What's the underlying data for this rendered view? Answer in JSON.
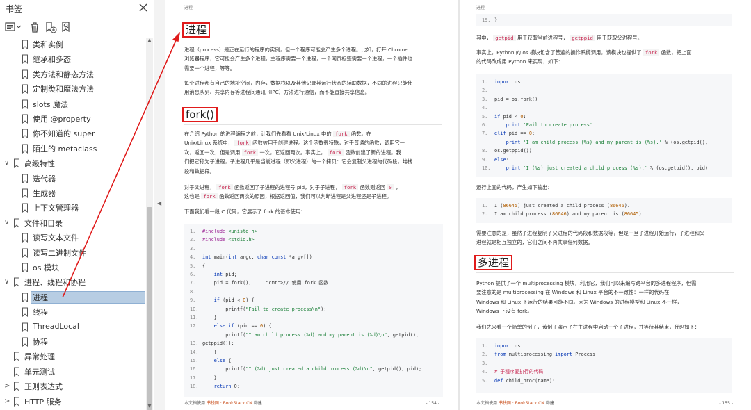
{
  "sidebar": {
    "title": "书签",
    "close_icon": "close-icon",
    "toolbar_icons": [
      "outline-menu-icon",
      "delete-bookmark-icon",
      "add-bookmark-icon",
      "find-bookmark-icon"
    ],
    "items": [
      {
        "label": "类和实例",
        "level": 2,
        "caret": ""
      },
      {
        "label": "继承和多态",
        "level": 2,
        "caret": ""
      },
      {
        "label": "类方法和静态方法",
        "level": 2,
        "caret": ""
      },
      {
        "label": "定制类和魔法方法",
        "level": 2,
        "caret": ""
      },
      {
        "label": "slots 魔法",
        "level": 2,
        "caret": ""
      },
      {
        "label": "使用 @property",
        "level": 2,
        "caret": ""
      },
      {
        "label": "你不知道的 super",
        "level": 2,
        "caret": ""
      },
      {
        "label": "陌生的 metaclass",
        "level": 2,
        "caret": ""
      },
      {
        "label": "高级特性",
        "level": 1,
        "caret": "∨"
      },
      {
        "label": "迭代器",
        "level": 2,
        "caret": ""
      },
      {
        "label": "生成器",
        "level": 2,
        "caret": ""
      },
      {
        "label": "上下文管理器",
        "level": 2,
        "caret": ""
      },
      {
        "label": "文件和目录",
        "level": 1,
        "caret": "∨"
      },
      {
        "label": "读写文本文件",
        "level": 2,
        "caret": ""
      },
      {
        "label": "读写二进制文件",
        "level": 2,
        "caret": ""
      },
      {
        "label": "os 模块",
        "level": 2,
        "caret": ""
      },
      {
        "label": "进程、线程和协程",
        "level": 1,
        "caret": "∨"
      },
      {
        "label": "进程",
        "level": 2,
        "caret": "",
        "active": true
      },
      {
        "label": "线程",
        "level": 2,
        "caret": ""
      },
      {
        "label": "ThreadLocal",
        "level": 2,
        "caret": ""
      },
      {
        "label": "协程",
        "level": 2,
        "caret": ""
      },
      {
        "label": "异常处理",
        "level": 1,
        "caret": ""
      },
      {
        "label": "单元测试",
        "level": 1,
        "caret": ""
      },
      {
        "label": "正则表达式",
        "level": 1,
        "caret": ">"
      },
      {
        "label": "HTTP 服务",
        "level": 1,
        "caret": ">"
      }
    ]
  },
  "page_left": {
    "header": "进程",
    "h_process": "进程",
    "p1": [
      "进程（process）是正在运行的程序的实例，但一个程序可能会产生多个进程。比如，打开 Chrome",
      "浏览器程序，它可能会产生多个进程，主程序需要一个进程，一个网页标签需要一个进程，一个插件也",
      "需要一个进程，等等。"
    ],
    "p2": [
      "每个进程都有自己的地址空间，内存，数据栈以及其他记录其运行状态的辅助数据，不同的进程只能使",
      "用消息队列、共享内存等进程间通讯（IPC）方法进行通信，而不能直接共享信息。"
    ],
    "h_fork": "fork()",
    "p3": [
      "在介绍 Python 的进程编程之前，让我们先看看 Unix/Linux 中的 |fork| 函数。在",
      "Unix/Linux 系统中， |fork| 函数被用于创建进程。这个函数很特殊，对于普通的函数，调用它一",
      "次，返回一次，但是调用 |fork| 一次，它返回两次。事实上， |fork| 函数创建了新的进程，我",
      "们把它称为子进程，子进程几乎是当前进程（即父进程）的一个拷贝：它会复制父进程的代码段，堆栈",
      "段和数据段。"
    ],
    "p4": [
      "对于父进程， |fork| 函数返回了子进程的进程号 pid，对于子进程， |fork| 函数则返回 |0| ，",
      "这也是 |fork| 函数返回两次的原因，根据返回值，我们可以判断进程是父进程还是子进程。"
    ],
    "p5": "下面我们看一段 C 代码，它展示了 fork 的基本使用：",
    "code": [
      {
        "n": "1.",
        "t": "#include <unistd.h>"
      },
      {
        "n": "2.",
        "t": "#include <stdio.h>"
      },
      {
        "n": "3.",
        "t": ""
      },
      {
        "n": "4.",
        "t": "int main(int argc, char const *argv[])"
      },
      {
        "n": "5.",
        "t": "{"
      },
      {
        "n": "6.",
        "t": "    int pid;"
      },
      {
        "n": "7.",
        "t": "    pid = fork();     // 使用 fork 函数"
      },
      {
        "n": "8.",
        "t": ""
      },
      {
        "n": "9.",
        "t": "    if (pid < 0) {"
      },
      {
        "n": "10.",
        "t": "        printf(\"Fail to create process\\n\");"
      },
      {
        "n": "11.",
        "t": "    }"
      },
      {
        "n": "12.",
        "t": "    else if (pid == 0) {"
      },
      {
        "n": "",
        "t": "        printf(\"I am child process (%d) and my parent is (%d)\\n\", getpid(),"
      },
      {
        "n": "13.",
        "t": "getppid());"
      },
      {
        "n": "14.",
        "t": "    }"
      },
      {
        "n": "15.",
        "t": "    else {"
      },
      {
        "n": "16.",
        "t": "        printf(\"I (%d) just created a child process (%d)\\n\", getpid(), pid);"
      },
      {
        "n": "17.",
        "t": "    }"
      },
      {
        "n": "18.",
        "t": "    return 0;"
      }
    ],
    "footer_prefix": "本文档使用 ",
    "footer_brand": "书栈网 · BookStack.CN",
    "footer_suffix": " 构建",
    "page_number": "- 154 -"
  },
  "page_right": {
    "header": "进程",
    "code_top": [
      {
        "n": "19.",
        "t": "}"
      }
    ],
    "p1": "其中， |getpid| 用于获取当前进程号， |getppid| 用于获取父进程号。",
    "p2": [
      "事实上，Python 的 os 模块包含了普遍的操作系统调用，该模块也提供了 |fork| 函数，把上面",
      "的代码改成用 Python 来实现，如下："
    ],
    "code_py": [
      {
        "n": "1.",
        "t": "import os"
      },
      {
        "n": "2.",
        "t": ""
      },
      {
        "n": "3.",
        "t": "pid = os.fork()"
      },
      {
        "n": "4.",
        "t": ""
      },
      {
        "n": "5.",
        "t": "if pid < 0:"
      },
      {
        "n": "6.",
        "t": "    print 'Fail to create process'"
      },
      {
        "n": "7.",
        "t": "elif pid == 0:"
      },
      {
        "n": "",
        "t": "    print 'I am child process (%s) and my parent is (%s).' % (os.getpid(),"
      },
      {
        "n": "8.",
        "t": "os.getppid())"
      },
      {
        "n": "9.",
        "t": "else:"
      },
      {
        "n": "10.",
        "t": "    print 'I (%s) just created a child process (%s).' % (os.getpid(), pid)"
      }
    ],
    "p3": "运行上面的代码，产生如下输出：",
    "code_out": [
      {
        "n": "1.",
        "t": "I (86645) just created a child process (86646)."
      },
      {
        "n": "2.",
        "t": "I am child process (86646) and my parent is (86645)."
      }
    ],
    "p4": [
      "需要注意的是，虽然子进程复制了父进程的代码段和数据段等，但是一旦子进程开始运行，子进程和父",
      "进程就是相互独立的，它们之间不再共享任何数据。"
    ],
    "h_multi": "多进程",
    "p5": [
      "Python 提供了一个 multiprocessing 模块，利用它，我们可以来编写跨平台的多进程程序，但需",
      "要注意的是 multiprocessing 在 Windows 和 Linux 平台的不一致性：一样的代码在",
      "Windows 和 Linux 下运行的结果可能不同。因为 Windows 的进程模型和 Linux 不一样，",
      "Windows 下没有 fork。"
    ],
    "p6": "我们先来看一个简单的例子，该例子演示了在主进程中启动一个子进程，并等待其结束，代码如下：",
    "code_mp": [
      {
        "n": "1.",
        "t": "import os"
      },
      {
        "n": "2.",
        "t": "from multiprocessing import Process"
      },
      {
        "n": "3.",
        "t": ""
      },
      {
        "n": "4.",
        "t": "# 子程序要执行的代码"
      },
      {
        "n": "5.",
        "t": "def child_proc(name):"
      }
    ],
    "footer_prefix": "本文档使用 ",
    "footer_brand": "书栈网 · BookStack.CN",
    "footer_suffix": " 构建",
    "page_number": "- 155 -"
  },
  "colors": {
    "annotation": "#e01b1b",
    "selection": "#b7cde3",
    "inline_code": "#c7254e"
  }
}
